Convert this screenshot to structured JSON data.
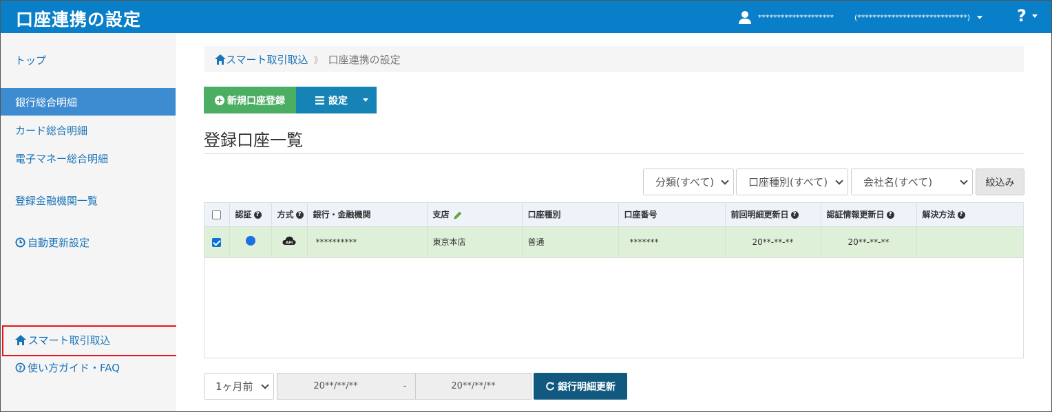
{
  "header": {
    "title": "口座連携の設定",
    "user_name": "********************",
    "organization": "(*****************************)",
    "help_label": "?"
  },
  "sidebar": {
    "items": [
      {
        "label": "トップ"
      },
      {
        "label": "銀行総合明細",
        "active": true
      },
      {
        "label": "カード総合明細"
      },
      {
        "label": "電子マネー総合明細"
      },
      {
        "label": "登録金融機関一覧"
      },
      {
        "label": "自動更新設定",
        "icon": "clock-icon"
      },
      {
        "label": "スマート取引取込",
        "icon": "home-icon",
        "highlighted": true
      },
      {
        "label": "使い方ガイド・FAQ",
        "icon": "question-circle-icon"
      }
    ]
  },
  "breadcrumb": {
    "home": "スマート取引取込",
    "separator": "》",
    "current": "口座連携の設定"
  },
  "toolbar": {
    "new_account_label": "新規口座登録",
    "settings_label": "設定"
  },
  "section": {
    "title": "登録口座一覧"
  },
  "filters": {
    "category": "分類(すべて)",
    "account_type": "口座種別(すべて)",
    "company": "会社名(すべて)",
    "apply_label": "絞込み"
  },
  "table": {
    "headers": [
      "認証",
      "方式",
      "銀行・金融機関",
      "支店",
      "口座種別",
      "口座番号",
      "前回明細更新日",
      "認証情報更新日",
      "解決方法"
    ],
    "rows": [
      {
        "checked": true,
        "auth_status": "blue-dot",
        "method": "API",
        "bank": "**********",
        "branch": "東京本店",
        "account_type": "普通",
        "account_number": "*******",
        "last_statement_update": "20**-**-**",
        "auth_info_update": "20**-**-**",
        "resolution": ""
      }
    ]
  },
  "bottom": {
    "period": "1ヶ月前",
    "date_from": "20**/**/**",
    "date_sep": "-",
    "date_to": "20**/**/**",
    "refresh_label": "銀行明細更新"
  },
  "colors": {
    "header_bg": "#0a7fc9",
    "active_sidebar": "#3d8bd0",
    "new_button": "#4cae63",
    "settings_button": "#1583b6",
    "refresh_button": "#11597f",
    "row_selected": "#dff0d8",
    "highlight_border": "#e8141b"
  }
}
